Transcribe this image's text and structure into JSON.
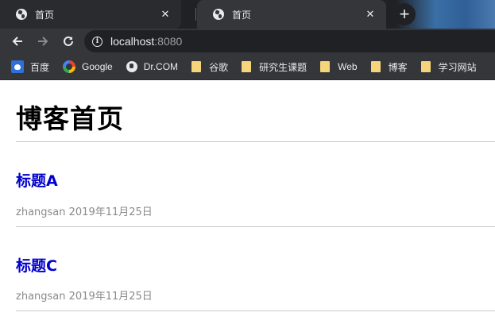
{
  "browser": {
    "tabs": [
      {
        "title": "首页",
        "close": "✕"
      },
      {
        "title": "首页",
        "close": "✕"
      }
    ],
    "new_tab": "+",
    "url": {
      "host": "localhost",
      "port": ":8080"
    },
    "bookmarks": [
      {
        "label": "百度",
        "icon": "baidu-icon"
      },
      {
        "label": "Google",
        "icon": "google-icon"
      },
      {
        "label": "Dr.COM",
        "icon": "globe-icon"
      },
      {
        "label": "谷歌",
        "icon": "folder-icon"
      },
      {
        "label": "研究生课题",
        "icon": "folder-icon"
      },
      {
        "label": "Web",
        "icon": "folder-icon"
      },
      {
        "label": "博客",
        "icon": "folder-icon"
      },
      {
        "label": "学习网站",
        "icon": "folder-icon"
      }
    ]
  },
  "page": {
    "title": "博客首页",
    "posts": [
      {
        "title": "标题A",
        "meta": "zhangsan 2019年11月25日"
      },
      {
        "title": "标题C",
        "meta": "zhangsan 2019年11月25日"
      }
    ]
  },
  "colors": {
    "link": "#0000cc",
    "meta": "#8a8a8a",
    "chrome_dark": "#35363a"
  }
}
